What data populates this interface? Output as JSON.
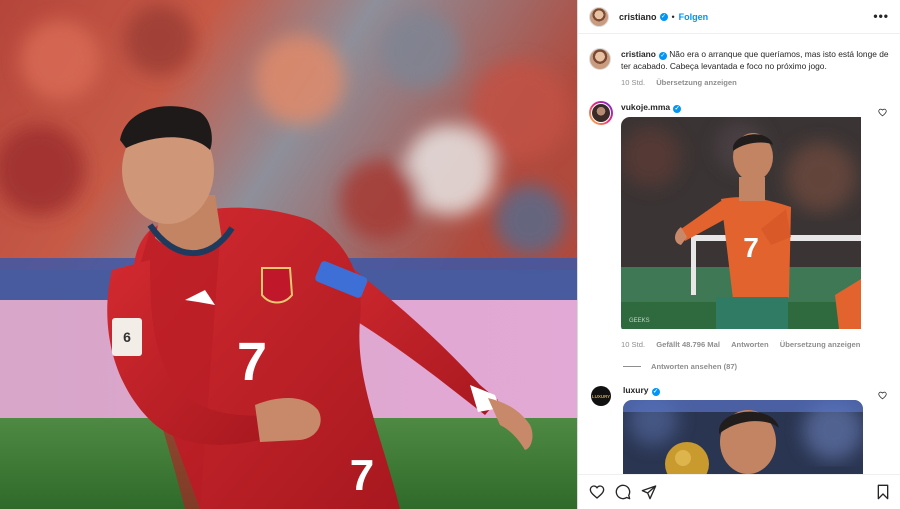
{
  "header": {
    "username": "cristiano",
    "separator": "•",
    "follow_label": "Folgen",
    "more_label": "•••"
  },
  "caption": {
    "username": "cristiano",
    "text": "Não era o arranque que queríamos, mas isto está longe de ter acabado. Cabeça levantada e foco no próximo jogo.",
    "time": "10 Std.",
    "translate_label": "Übersetzung anzeigen"
  },
  "comments": [
    {
      "username": "vukoje.mma",
      "time": "10 Std.",
      "likes": "Gefällt 48.796 Mal",
      "reply_label": "Antworten",
      "translate_label": "Übersetzung anzeigen",
      "view_replies": "Antworten ansehen (87)"
    },
    {
      "username": "luxury",
      "avatar_text": "LUXURY"
    }
  ],
  "media": {
    "jersey_number": "7",
    "photo_credit": "GEEKS"
  },
  "icons": {
    "like": "heart-icon",
    "comment": "comment-icon",
    "share": "share-icon",
    "save": "bookmark-icon",
    "verified": "verified-badge-icon"
  },
  "colors": {
    "accent": "#0095f6",
    "text": "#262626",
    "muted": "#8e8e8e",
    "jersey": "#c8252c"
  }
}
